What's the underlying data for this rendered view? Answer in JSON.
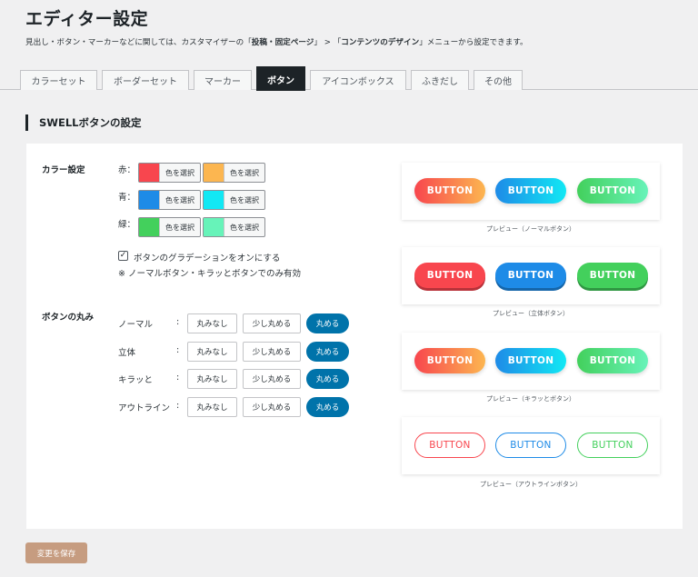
{
  "header": {
    "title": "エディター設定",
    "desc_1": "見出し・ボタン・マーカーなどに関しては、カスタマイザーの「",
    "desc_bold_1": "投稿・固定ページ",
    "desc_2": "」 > 「",
    "desc_bold_2": "コンテンツのデザイン",
    "desc_3": "」メニューから設定できます。"
  },
  "tabs": [
    "カラーセット",
    "ボーダーセット",
    "マーカー",
    "ボタン",
    "アイコンボックス",
    "ふきだし",
    "その他"
  ],
  "active_tab": "ボタン",
  "section_title": "SWELLボタンの設定",
  "color_settings": {
    "label": "カラー設定",
    "pick_label": "色を選択",
    "rows": [
      {
        "label": "赤：",
        "color1": "#f8464e",
        "color2": "#fcb650"
      },
      {
        "label": "青：",
        "color1": "#1e8be7",
        "color2": "#12e8f4"
      },
      {
        "label": "緑：",
        "color1": "#43d05c",
        "color2": "#67f3b9"
      }
    ],
    "gradient_checkbox_label": "ボタンのグラデーションをオンにする",
    "gradient_checked": true,
    "note": "※ ノーマルボタン・キラッとボタンでのみ有効"
  },
  "roundness": {
    "label": "ボタンの丸み",
    "options": [
      "丸みなし",
      "少し丸める",
      "丸める"
    ],
    "rows": [
      {
        "label": "ノーマル",
        "selected": "丸める"
      },
      {
        "label": "立体",
        "selected": "丸める"
      },
      {
        "label": "キラッと",
        "selected": "丸める"
      },
      {
        "label": "アウトライン",
        "selected": "丸める"
      }
    ]
  },
  "preview": {
    "button_text": "BUTTON",
    "captions": [
      "プレビュー（ノーマルボタン）",
      "プレビュー（立体ボタン）",
      "プレビュー（キラッとボタン）",
      "プレビュー（アウトラインボタン）"
    ]
  },
  "save_button": "変更を保存",
  "colors": {
    "red": "#f8464e",
    "red_light": "#fcb650",
    "blue": "#1e8be7",
    "blue_light": "#12e8f4",
    "green": "#43d05c",
    "green_light": "#67f3b9",
    "accent": "#0073aa",
    "save": "#c69c80"
  }
}
